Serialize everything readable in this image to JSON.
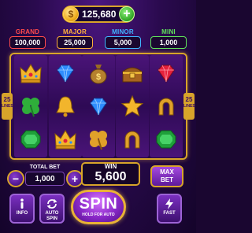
{
  "header": {
    "balance": "125,680",
    "coin_symbol": "$",
    "add_label": "+"
  },
  "jackpots": [
    {
      "label": "GRAND",
      "value": "100,000",
      "color": "#ff4a4a"
    },
    {
      "label": "MAJOR",
      "value": "25,000",
      "color": "#ffb13b"
    },
    {
      "label": "MINOR",
      "value": "5,000",
      "color": "#3fb6ff"
    },
    {
      "label": "MINI",
      "value": "1,000",
      "color": "#5fe35a"
    }
  ],
  "reels": {
    "lines_left": {
      "number": "25",
      "label": "LINES"
    },
    "lines_right": {
      "number": "25",
      "label": "LINES"
    },
    "grid": [
      [
        "crown-icon",
        "diamond-blue-icon",
        "money-bag-icon",
        "treasure-chest-icon",
        "ruby-icon"
      ],
      [
        "clover-icon",
        "bell-icon",
        "diamond-blue-icon",
        "star-icon",
        "horseshoe-icon"
      ],
      [
        "emerald-icon",
        "crown-icon",
        "clover-gold-icon",
        "horseshoe-icon",
        "emerald-icon"
      ]
    ]
  },
  "controls": {
    "total_bet_label": "TOTAL BET",
    "total_bet_value": "1,000",
    "minus_label": "−",
    "plus_label": "+",
    "win_label": "WIN",
    "win_value": "5,600",
    "max_bet_line1": "MAX",
    "max_bet_line2": "BET",
    "info_label": "INFO",
    "auto_spin_line1": "AUTO",
    "auto_spin_line2": "SPIN",
    "spin_label": "SPIN",
    "spin_sub_label": "HOLD FOR AUTO",
    "fast_label": "FAST"
  },
  "colors": {
    "gold": "#d8a42a",
    "background": "#2a0a4e",
    "accent_purple": "#8a28c8"
  }
}
